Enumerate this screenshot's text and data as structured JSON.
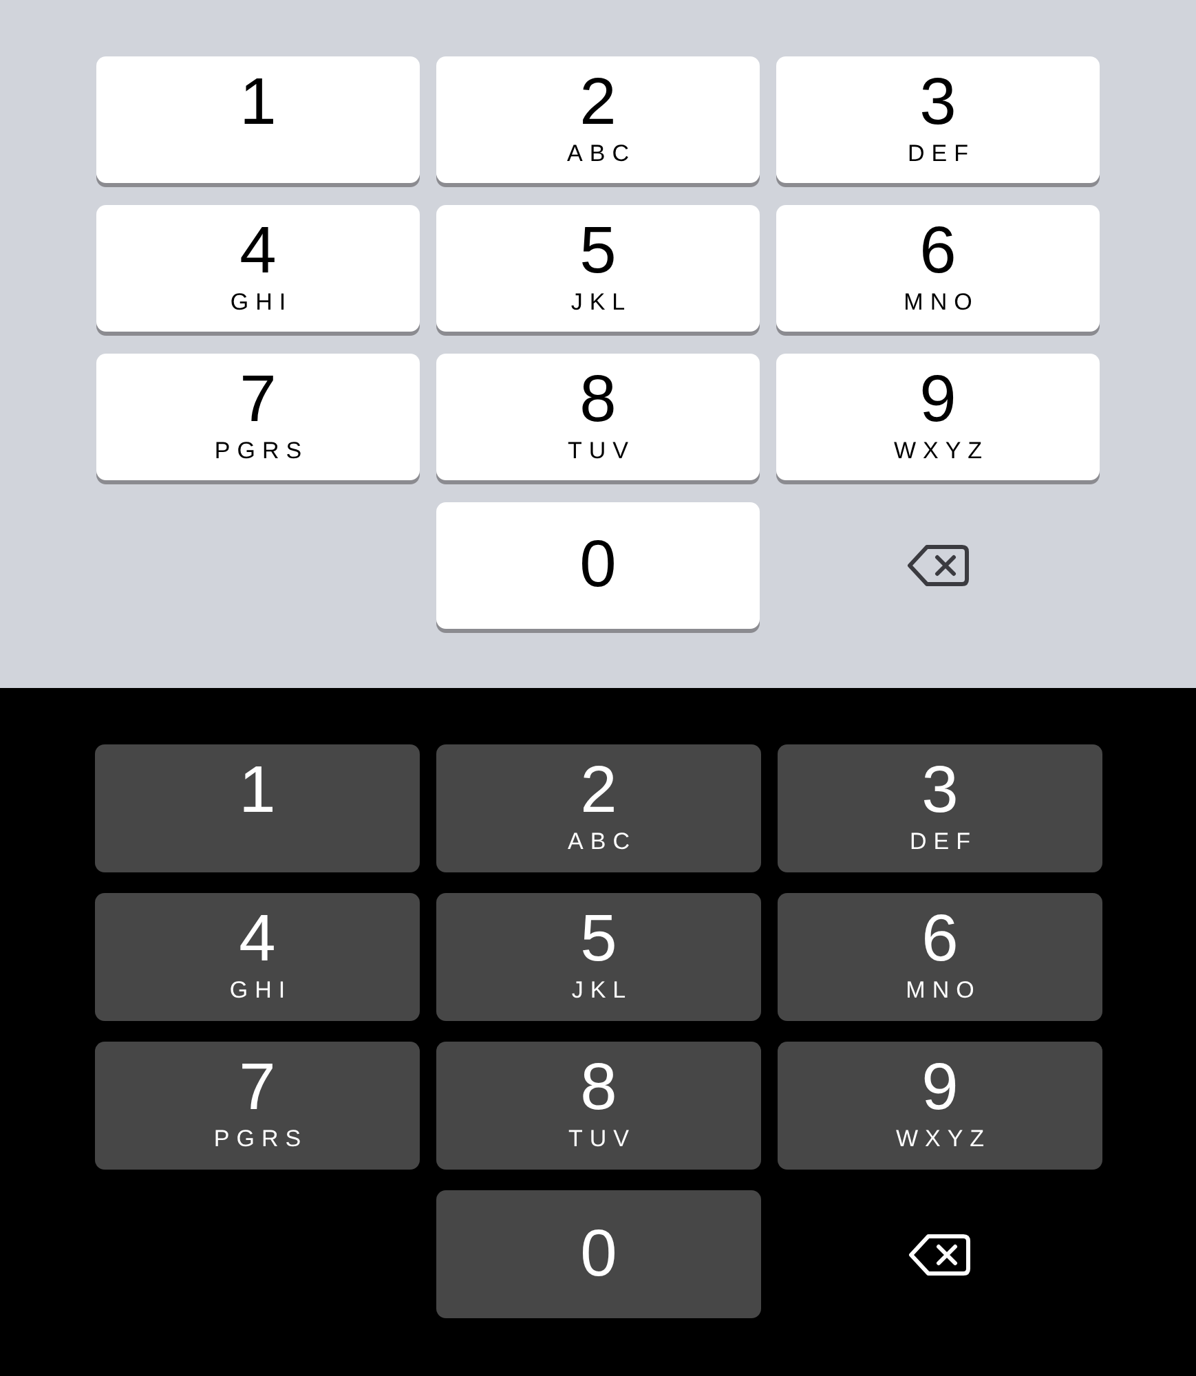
{
  "keypads": [
    {
      "dark": false,
      "keys": [
        {
          "kind": "digit",
          "digit": "1"
        },
        {
          "kind": "digit",
          "digit": "2",
          "letters": "ABC"
        },
        {
          "kind": "digit",
          "digit": "3",
          "letters": "DEF"
        },
        {
          "kind": "digit",
          "digit": "4",
          "letters": "GHI"
        },
        {
          "kind": "digit",
          "digit": "5",
          "letters": "JKL"
        },
        {
          "kind": "digit",
          "digit": "6",
          "letters": "MNO"
        },
        {
          "kind": "digit",
          "digit": "7",
          "letters": "PGRS"
        },
        {
          "kind": "digit",
          "digit": "8",
          "letters": "TUV"
        },
        {
          "kind": "digit",
          "digit": "9",
          "letters": "WXYZ"
        },
        {
          "kind": "digit",
          "digit": "0"
        },
        {
          "kind": "delete"
        }
      ]
    },
    {
      "dark": true,
      "keys": [
        {
          "kind": "digit",
          "digit": "1"
        },
        {
          "kind": "digit",
          "digit": "2",
          "letters": "ABC"
        },
        {
          "kind": "digit",
          "digit": "3",
          "letters": "DEF"
        },
        {
          "kind": "digit",
          "digit": "4",
          "letters": "GHI"
        },
        {
          "kind": "digit",
          "digit": "5",
          "letters": "JKL"
        },
        {
          "kind": "digit",
          "digit": "6",
          "letters": "MNO"
        },
        {
          "kind": "digit",
          "digit": "7",
          "letters": "PGRS"
        },
        {
          "kind": "digit",
          "digit": "8",
          "letters": "TUV"
        },
        {
          "kind": "digit",
          "digit": "9",
          "letters": "WXYZ"
        },
        {
          "kind": "digit",
          "digit": "0"
        },
        {
          "kind": "delete"
        }
      ]
    }
  ]
}
